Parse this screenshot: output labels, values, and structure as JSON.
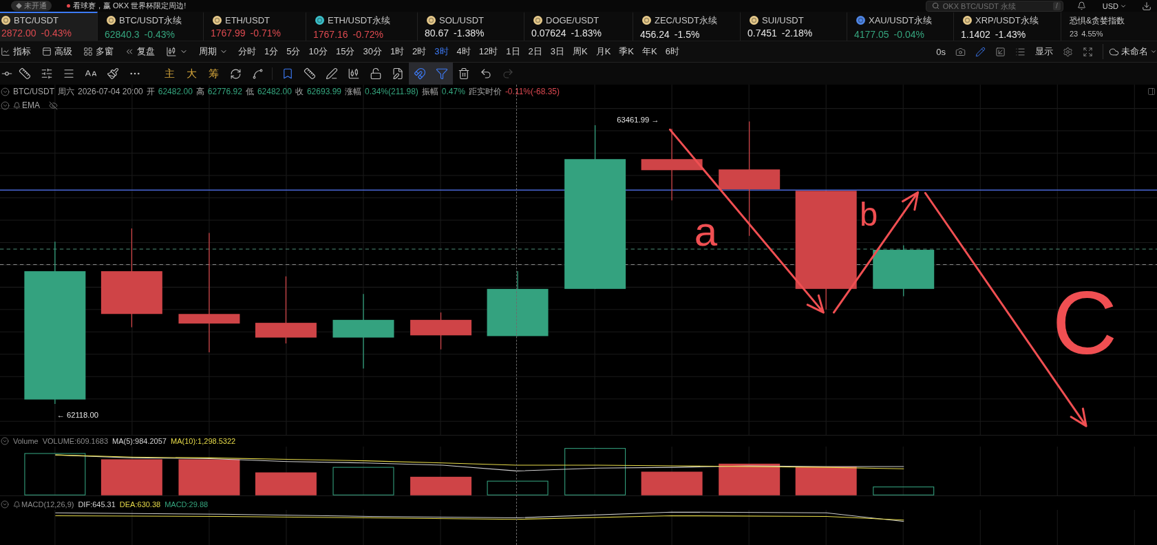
{
  "top_bar": {
    "badge": "未开通",
    "promo": "看球赛，赢 OKX 世界杯限定周边!",
    "search": {
      "placeholder": "OKX BTC/USDT 永续",
      "shortcut": "/"
    },
    "currency": "USD"
  },
  "tickers": [
    {
      "name": "BTC/USDT",
      "coin": {
        "color": "#e6c98a"
      },
      "price": "2872.00",
      "change": "-0.43%",
      "color": "#de4a50",
      "selected": true
    },
    {
      "name": "BTC/USDT永续",
      "coin": {
        "color": "#e6c98a"
      },
      "price": "62840.3",
      "change": "-0.43%",
      "color": "#35a57e",
      "selected": false
    },
    {
      "name": "ETH/USDT",
      "coin": {
        "color": "#e6c98a"
      },
      "price": "1767.99",
      "change": "-0.71%",
      "color": "#de4a50",
      "selected": false
    },
    {
      "name": "ETH/USDT永续",
      "coin": {
        "color": "#3bbfc9"
      },
      "price": "1767.16",
      "change": "-0.72%",
      "color": "#de4a50",
      "selected": false
    },
    {
      "name": "SOL/USDT",
      "coin": {
        "color": "#e6c98a"
      },
      "price": "80.67",
      "change": "-1.38%",
      "color": "#e8e8e8",
      "selected": false
    },
    {
      "name": "DOGE/USDT",
      "coin": {
        "color": "#e6c98a"
      },
      "price": "0.07624",
      "change": "-1.83%",
      "color": "#e8e8e8",
      "selected": false
    },
    {
      "name": "ZEC/USDT永续",
      "coin": {
        "color": "#e6c98a"
      },
      "price": "456.24",
      "change": "-1.5%",
      "color": "#e8e8e8",
      "selected": false
    },
    {
      "name": "SUI/USDT",
      "coin": {
        "color": "#e6c98a"
      },
      "price": "0.7451",
      "change": "-2.18%",
      "color": "#e8e8e8",
      "selected": false
    },
    {
      "name": "XAU/USDT永续",
      "coin": {
        "color": "#4f86e6"
      },
      "price": "4177.05",
      "change": "-0.04%",
      "color": "#35a57e",
      "selected": false
    },
    {
      "name": "XRP/USDT永续",
      "coin": {
        "color": "#e6c98a"
      },
      "price": "1.1402",
      "change": "-1.43%",
      "color": "#e8e8e8",
      "selected": false
    }
  ],
  "fear_greed": {
    "title": "恐惧&贪婪指数",
    "value": "23",
    "change": "4.55%"
  },
  "toolbar": {
    "menus": [
      "指标",
      "高级",
      "多窗",
      "复盘"
    ],
    "period_menu": "周期",
    "periods": [
      {
        "label": "分时",
        "selected": false
      },
      {
        "label": "1分",
        "selected": false
      },
      {
        "label": "5分",
        "selected": false
      },
      {
        "label": "10分",
        "selected": false
      },
      {
        "label": "15分",
        "selected": false
      },
      {
        "label": "30分",
        "selected": false
      },
      {
        "label": "1时",
        "selected": false
      },
      {
        "label": "2时",
        "selected": false
      },
      {
        "label": "3时",
        "selected": true
      },
      {
        "label": "4时",
        "selected": false
      },
      {
        "label": "12时",
        "selected": false
      },
      {
        "label": "1日",
        "selected": false
      },
      {
        "label": "2日",
        "selected": false
      },
      {
        "label": "3日",
        "selected": false
      },
      {
        "label": "周K",
        "selected": false
      },
      {
        "label": "月K",
        "selected": false
      },
      {
        "label": "季K",
        "selected": false
      },
      {
        "label": "年K",
        "selected": false
      },
      {
        "label": "6时",
        "selected": false
      }
    ],
    "tools": [
      {
        "kind": "text",
        "label": "0s",
        "active": false
      },
      {
        "kind": "icon",
        "active": false
      },
      {
        "kind": "icon",
        "active": true
      },
      {
        "kind": "icon",
        "active": false
      },
      {
        "kind": "icon",
        "active": false
      },
      {
        "kind": "text",
        "label": "显示",
        "active": false
      },
      {
        "kind": "icon",
        "active": false
      },
      {
        "kind": "icon",
        "active": false
      }
    ],
    "layout_name": "未命名"
  },
  "draw_toolbar": {
    "shortcuts": [
      "主",
      "大",
      "筹"
    ],
    "tools": [
      {
        "active": true,
        "pressed": false,
        "disabled": false
      },
      {
        "active": false,
        "pressed": false,
        "disabled": false
      },
      {
        "active": false,
        "pressed": false,
        "disabled": false
      },
      {
        "active": false,
        "pressed": false,
        "disabled": false
      },
      {
        "active": false,
        "pressed": false,
        "disabled": false
      },
      {
        "active": false,
        "pressed": false,
        "disabled": false
      },
      {
        "active": true,
        "pressed": true,
        "disabled": false
      },
      {
        "active": true,
        "pressed": true,
        "disabled": false
      },
      {
        "active": false,
        "pressed": false,
        "disabled": false
      },
      {
        "active": false,
        "pressed": false,
        "disabled": false
      },
      {
        "active": false,
        "pressed": false,
        "disabled": true
      }
    ]
  },
  "chart": {
    "symbol": "BTC/USDT",
    "weekday": "周六",
    "datetime": "2026-07-04 20:00",
    "fields": [
      {
        "label": "开",
        "value": "62482.00",
        "color": "#35a57e"
      },
      {
        "label": "高",
        "value": "62776.92",
        "color": "#35a57e"
      },
      {
        "label": "低",
        "value": "62482.00",
        "color": "#35a57e"
      },
      {
        "label": "收",
        "value": "62693.99",
        "color": "#35a57e"
      },
      {
        "label": "涨幅",
        "value": "0.34%(211.98)",
        "color": "#35a57e"
      },
      {
        "label": "振幅",
        "value": "0.47%",
        "color": "#35a57e"
      },
      {
        "label": "距实时价",
        "value": "-0.11%(-68.35)",
        "color": "#d9474f"
      }
    ],
    "indicator": "EMA",
    "high_label": "63461.99 →",
    "low_label": "← 62118.00",
    "wave_labels": [
      "a",
      "b",
      "C"
    ]
  },
  "volume": {
    "title": "Volume",
    "readings": [
      {
        "text": "VOLUME:609.1683",
        "color": "#8c8c8c"
      },
      {
        "text": "MA(5):984.2057",
        "color": "#d6d6d6"
      },
      {
        "text": "MA(10):1,298.5322",
        "color": "#e8dc4a"
      }
    ]
  },
  "macd": {
    "title": "MACD(12,26,9)",
    "readings": [
      {
        "text": "DIF:645.31",
        "color": "#d6d6d6"
      },
      {
        "text": "DEA:630.38",
        "color": "#e8dc4a"
      },
      {
        "text": "MACD:29.88",
        "color": "#35a57e"
      }
    ]
  }
}
